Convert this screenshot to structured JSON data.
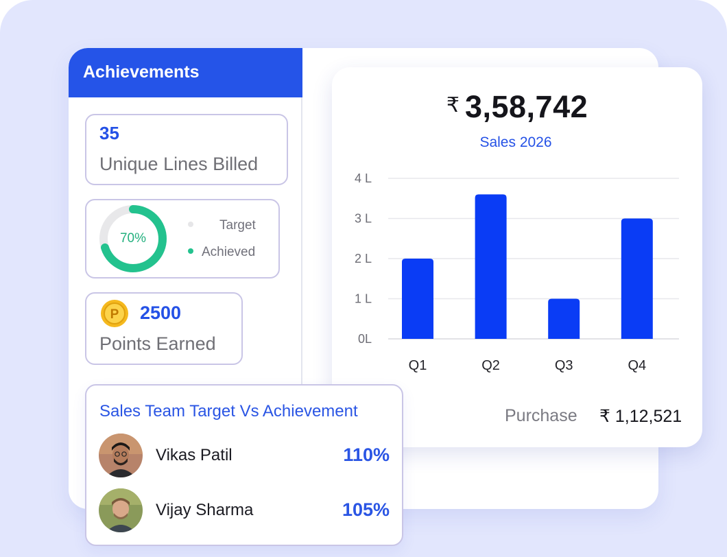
{
  "achievements": {
    "title": "Achievements",
    "lines": {
      "value": "35",
      "label": "Unique Lines Billed"
    },
    "target": {
      "percent_label": "70%",
      "percent": 70,
      "legend_target": "Target",
      "legend_achieved": "Achieved",
      "color_achieved": "#23c28e",
      "color_track": "#e8e8ea"
    },
    "points": {
      "value": "2500",
      "label": "Points Earned",
      "coin_letter": "P"
    }
  },
  "team": {
    "title": "Sales Team Target Vs Achievement",
    "members": [
      {
        "name": "Vikas Patil",
        "percent": "110%"
      },
      {
        "name": "Vijay Sharma",
        "percent": "105%"
      }
    ]
  },
  "sales": {
    "currency": "₹",
    "total": "3,58,742",
    "subtitle": "Sales 2026",
    "purchase_label": "Purchase",
    "purchase_value": "₹ 1,12,521"
  },
  "chart_data": {
    "type": "bar",
    "categories": [
      "Q1",
      "Q2",
      "Q3",
      "Q4"
    ],
    "values": [
      2.0,
      3.6,
      1.0,
      3.0
    ],
    "yticks": [
      "0L",
      "1 L",
      "2 L",
      "3 L",
      "4 L"
    ],
    "ylim": [
      0,
      4
    ],
    "grid": true,
    "bar_color": "#0a3cf5"
  }
}
